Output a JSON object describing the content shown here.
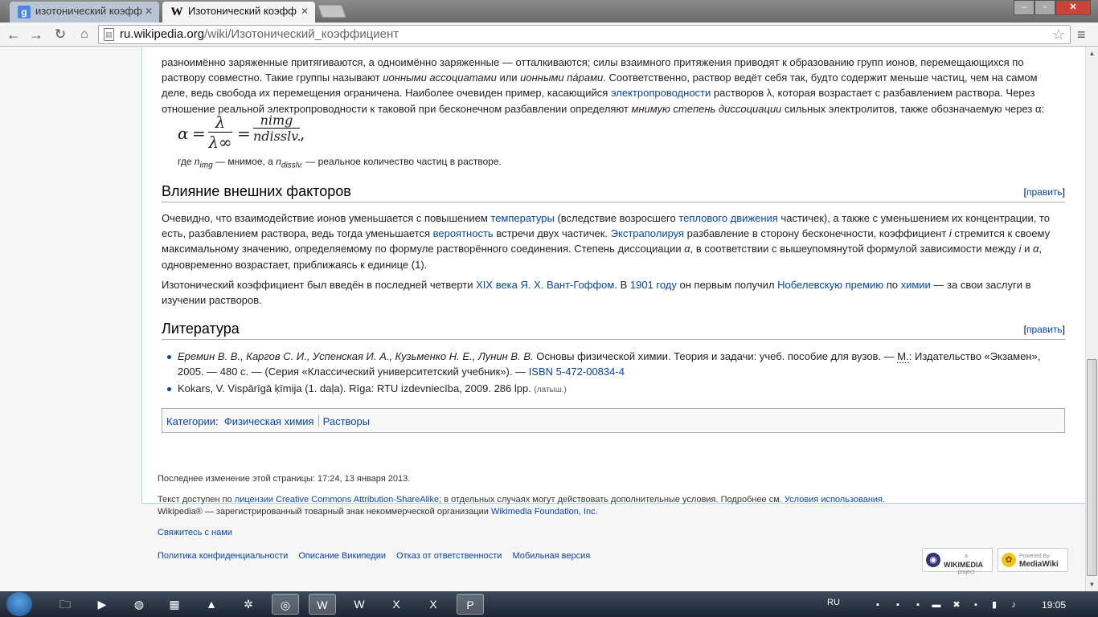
{
  "browser": {
    "tabs": [
      {
        "label": "изотонический коэфф",
        "favicon": "g"
      },
      {
        "label": "Изотонический коэфф",
        "favicon": "W"
      }
    ],
    "window_buttons": {
      "minimize": "–",
      "maximize": "▫",
      "close": "✕"
    },
    "url_host": "ru.wikipedia.org",
    "url_path": "/wiki/Изотонический_коэффициент"
  },
  "article": {
    "para1_line0": "разноимённо заряженные притягиваются, а одноимённо заряженные — отталкиваются; силы взаимного притяжения приводят к образованию групп ионов, перемещающихся по",
    "para1_line1a": "раствору совместно. Такие группы называют ",
    "para1_italic1": "ионными ассоциатами",
    "para1_or": " или ",
    "para1_italic2": "ионными пáрами",
    "para1_line1b": ". Соответственно, раствор ведёт себя так, будто содержит меньше частиц, чем на самом деле,",
    "para1_line2a": "ведь свобода их перемещения ограничена. Наиболее очевиден пример, касающийся ",
    "para1_link_conduct": "электропроводности",
    "para1_line2b": " растворов λ, которая возрастает с разбавлением раствора. Через отношение",
    "para1_line3a": "реальной электропроводности к таковой при бесконечном разбавлении определяют ",
    "para1_italic3": "мнимую степень диссоциации",
    "para1_line3b": " сильных электролитов, также обозначаемую через α:",
    "formula": {
      "alpha": "α",
      "eq": "=",
      "lambda": "λ",
      "lambda_inf": "λ∞",
      "n_img": "nimg",
      "n_dissl": "ndisslv.",
      "comma": ","
    },
    "formula_note_pre": "где ",
    "formula_note_n1": "n",
    "formula_note_sub1": "img",
    "formula_note_mid": " — мнимое, а ",
    "formula_note_n2": "n",
    "formula_note_sub2": "disslv.",
    "formula_note_post": " — реальное количество частиц в растворе.",
    "h_factors": "Влияние внешних факторов",
    "edit_label": "[править]",
    "para2_a": "Очевидно, что взаимодействие ионов уменьшается с повышением ",
    "para2_link_temp": "температуры",
    "para2_b": " (вследствие возросшего ",
    "para2_link_thermal": "теплового движения",
    "para2_c": " частичек), а также с уменьшением их концентрации, то есть, разбавлением раствора, ведь тогда уменьшается ",
    "para2_link_prob": "вероятность",
    "para2_d": " встречи двух частичек. ",
    "para2_link_extrap": "Экстраполируя",
    "para2_e": " разбавление в сторону бесконечности, коэффициент ",
    "para2_i": "i",
    "para2_f": " стремится к своему максимальному значению, определяемому по формуле растворённого соединения. Степень диссоциации ",
    "para2_alpha": "α",
    "para2_g": ", в соответствии с вышеупомянутой формулой зависимости между ",
    "para2_i2": "i",
    "para2_h": " и ",
    "para2_alpha2": "α",
    "para2_j": ", одновременно возрастает, приближаясь к единице (1).",
    "para3_a": "Изотонический коэффициент был введён в последней четверти ",
    "para3_link_century": "XIX века",
    "para3_b": " ",
    "para3_link_vanthoff": "Я. Х. Вант-Гоффом",
    "para3_c": ". В ",
    "para3_link_1901": "1901 году",
    "para3_d": " он первым получил ",
    "para3_link_nobel": "Нобелевскую премию",
    "para3_e": " по ",
    "para3_link_chem": "химии",
    "para3_f": " — за свои заслуги в изучении растворов.",
    "h_lit": "Литература",
    "lit1_authors": "Еремин В. В., Каргов С. И., Успенская И. А., Кузьменко Н. Е., Лунин В. В.",
    "lit1_a": " Основы физической химии. Теория и задачи: учеб. пособие для вузов. — ",
    "lit1_m": "М.",
    "lit1_b": ": Издательство «Экзамен», 2005. — 480 с. — (Серия «Классический университетский учебник»). — ",
    "lit1_isbn": "ISBN 5-472-00834-4",
    "lit2": "Kokars, V. Vispārīgā ķīmija (1. daļa). Rīga: RTU izdevniecība, 2009. 286 lpp.",
    "lit2_lang": "(латыш.)",
    "categories_label": "Категории",
    "categories_colon": ":",
    "cat1": "Физическая химия",
    "cat2": "Растворы"
  },
  "footer": {
    "lastmod": "Последнее изменение этой страницы: 17:24, 13 января 2013.",
    "license_a": "Текст доступен по ",
    "license_link": "лицензии Creative Commons Attribution-ShareAlike",
    "license_b": "; в отдельных случаях могут действовать дополнительные условия. Подробнее см. ",
    "terms_link": "Условия использования",
    "license_c": ".",
    "trademark_a": "Wikipedia® — зарегистрированный товарный знак некоммерческой организации ",
    "trademark_link": "Wikimedia Foundation, Inc.",
    "contact": "Свяжитесь с нами",
    "links": [
      "Политика конфиденциальности",
      "Описание Википедии",
      "Отказ от ответственности",
      "Мобильная версия"
    ],
    "wm_badge_line1": "a",
    "wm_badge_line2": "WIKIMEDIA",
    "wm_badge_line3": "project",
    "mw_badge_line1": "Powered By",
    "mw_badge_line2": "MediaWiki"
  },
  "taskbar": {
    "lang": "RU",
    "clock": "19:05"
  },
  "colors": {
    "link": "#0645ad",
    "content_border": "#a7d7f9"
  }
}
